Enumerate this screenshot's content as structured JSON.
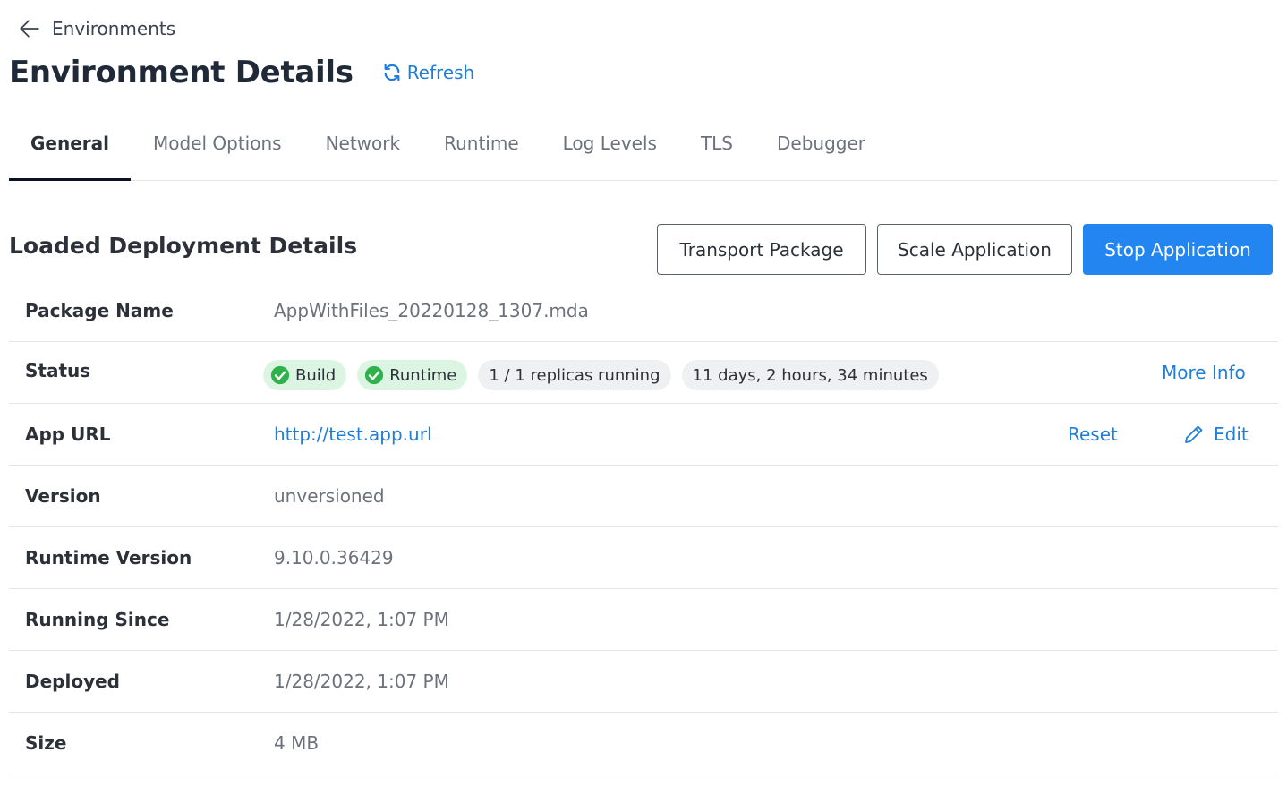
{
  "breadcrumb": {
    "back_label": "Environments"
  },
  "header": {
    "title": "Environment Details",
    "refresh_label": "Refresh"
  },
  "tabs": [
    {
      "label": "General",
      "active": true
    },
    {
      "label": "Model Options"
    },
    {
      "label": "Network"
    },
    {
      "label": "Runtime"
    },
    {
      "label": "Log Levels"
    },
    {
      "label": "TLS"
    },
    {
      "label": "Debugger"
    }
  ],
  "section": {
    "title": "Loaded Deployment Details"
  },
  "actions": {
    "transport_label": "Transport Package",
    "scale_label": "Scale Application",
    "stop_label": "Stop Application"
  },
  "details": {
    "package_name": {
      "label": "Package Name",
      "value": "AppWithFiles_20220128_1307.mda"
    },
    "status": {
      "label": "Status",
      "build_badge": "Build",
      "runtime_badge": "Runtime",
      "replicas": "1 / 1 replicas running",
      "uptime": "11 days, 2 hours, 34 minutes",
      "more_info": "More Info"
    },
    "app_url": {
      "label": "App URL",
      "value": "http://test.app.url",
      "reset_label": "Reset",
      "edit_label": "Edit"
    },
    "version": {
      "label": "Version",
      "value": "unversioned"
    },
    "runtime_version": {
      "label": "Runtime Version",
      "value": "9.10.0.36429"
    },
    "running_since": {
      "label": "Running Since",
      "value": "1/28/2022, 1:07 PM"
    },
    "deployed": {
      "label": "Deployed",
      "value": "1/28/2022, 1:07 PM"
    },
    "size": {
      "label": "Size",
      "value": "4 MB"
    }
  },
  "colors": {
    "accent": "#2386f0",
    "link": "#1f7ed9",
    "success": "#2fb24c",
    "success_bg": "#dcf5e2"
  },
  "icons": [
    "arrow-left-icon",
    "refresh-icon",
    "check-circle-icon",
    "pencil-icon"
  ]
}
